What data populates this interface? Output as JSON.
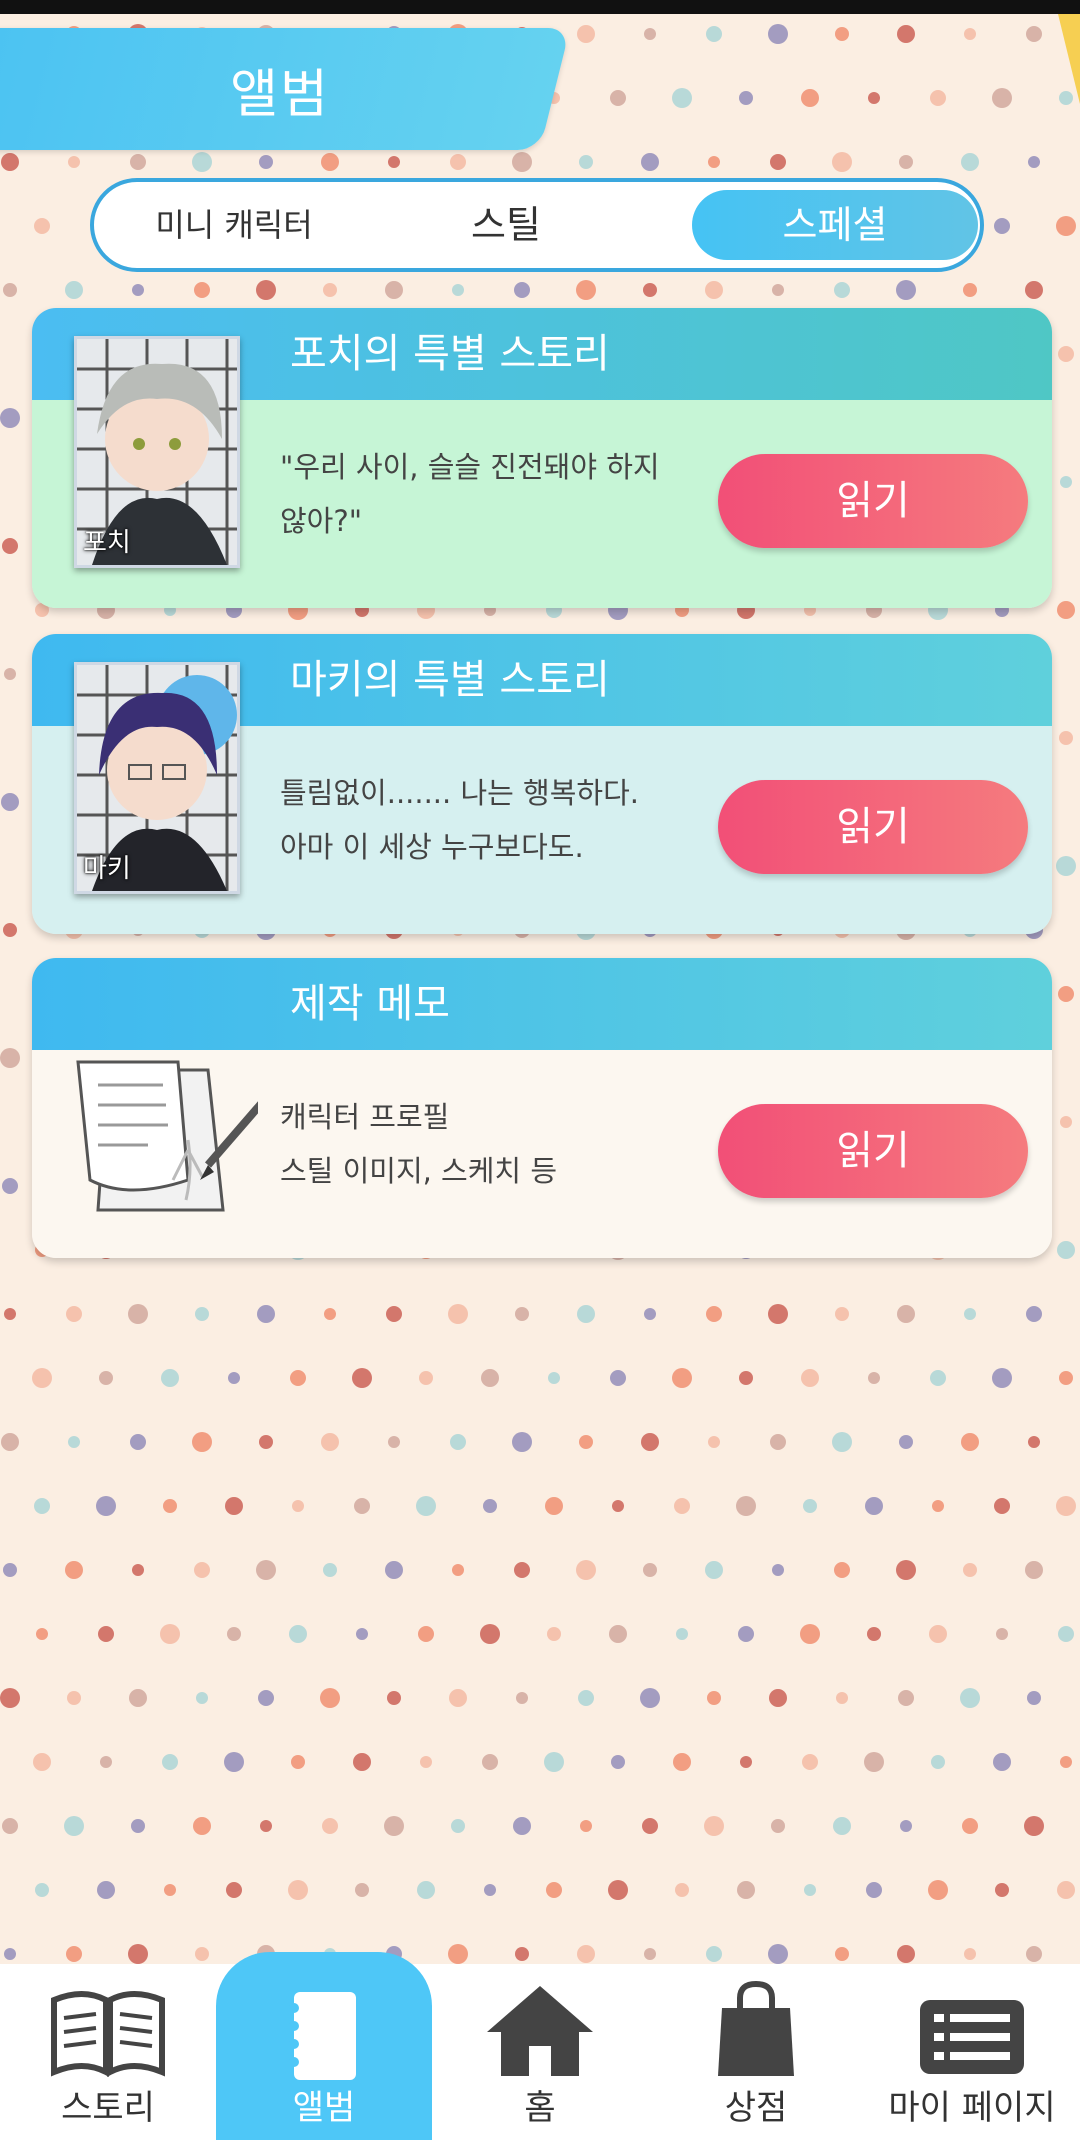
{
  "header": {
    "title": "앨범"
  },
  "tabs": [
    {
      "label": "미니 캐릭터",
      "active": false
    },
    {
      "label": "스틸",
      "active": false
    },
    {
      "label": "스페셜",
      "active": true
    }
  ],
  "cards": [
    {
      "title": "포치의 특별 스토리",
      "line1": "\"우리 사이, 슬슬 진전돼야 하지",
      "line2": "않아?\"",
      "thumb_name": "포치",
      "button": "읽기"
    },
    {
      "title": "마키의 특별 스토리",
      "line1": "틀림없이....... 나는 행복하다.",
      "line2": "아마 이 세상 누구보다도.",
      "thumb_name": "마키",
      "button": "읽기"
    },
    {
      "title": "제작 메모",
      "line1": "캐릭터 프로필",
      "line2": "스틸 이미지, 스케치 등",
      "button": "읽기"
    }
  ],
  "nav": [
    {
      "label": "스토리",
      "icon": "book-icon",
      "active": false
    },
    {
      "label": "앨범",
      "icon": "album-icon",
      "active": true
    },
    {
      "label": "홈",
      "icon": "home-icon",
      "active": false
    },
    {
      "label": "상점",
      "icon": "shop-bag-icon",
      "active": false
    },
    {
      "label": "마이 페이지",
      "icon": "list-icon",
      "active": false
    }
  ],
  "colors": {
    "accent": "#4ec7f7",
    "read_button": "#f24f77",
    "card1_body": "#c6f5d6",
    "card2_body": "#d6f0f0",
    "card3_body": "#fcf7f0"
  }
}
